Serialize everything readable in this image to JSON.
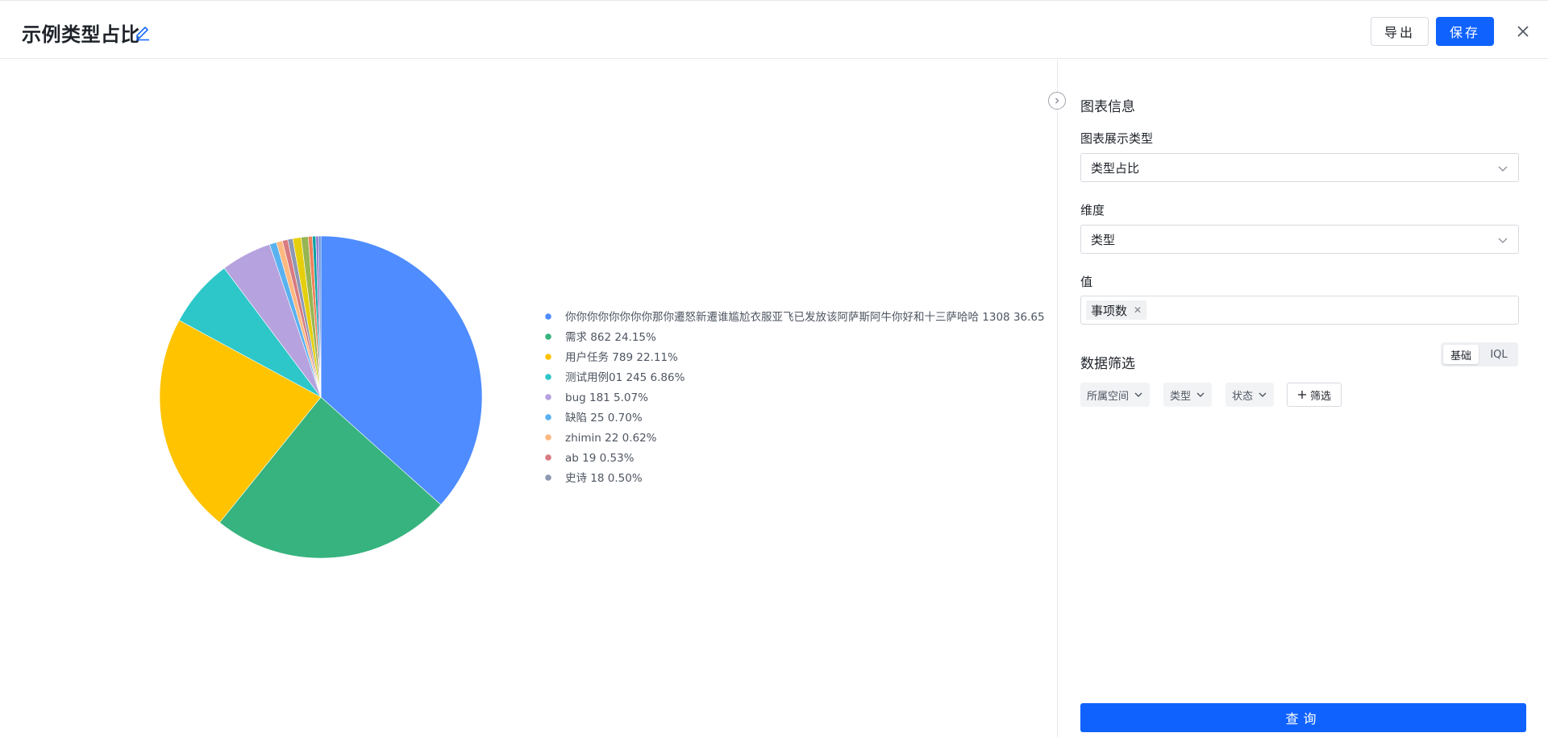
{
  "header": {
    "title": "示例类型占比",
    "export_label": "导出",
    "save_label": "保存"
  },
  "icons": {
    "edit": "pencil-icon",
    "close": "close-icon",
    "collapse": "chevron-right-circle-icon"
  },
  "panel": {
    "section_title": "图表信息",
    "chart_type_label": "图表展示类型",
    "chart_type_value": "类型占比",
    "dimension_label": "维度",
    "dimension_value": "类型",
    "value_label": "值",
    "value_tag": "事项数",
    "filter_title": "数据筛选",
    "mode_basic": "基础",
    "mode_iql": "IQL",
    "filters": [
      "所属空间",
      "类型",
      "状态"
    ],
    "add_filter_label": "筛选",
    "query_label": "查询"
  },
  "colors": {
    "primary": "#0f62fe",
    "border": "#d7dadf"
  },
  "chart_data": {
    "type": "pie",
    "legend_position": "right",
    "slices": [
      {
        "name": "你你你你你你你你那你遷怒新遷谁尴尬衣服亚飞已发放该阿萨斯阿牛你好和十三萨哈哈",
        "value": 1308,
        "percent": "36.65",
        "color": "#4e8cff"
      },
      {
        "name": "需求",
        "value": 862,
        "percent": "24.15%",
        "color": "#36b37e"
      },
      {
        "name": "用户任务",
        "value": 789,
        "percent": "22.11%",
        "color": "#ffc300"
      },
      {
        "name": "测试用例01",
        "value": 245,
        "percent": "6.86%",
        "color": "#2ec7c9"
      },
      {
        "name": "bug",
        "value": 181,
        "percent": "5.07%",
        "color": "#b6a2de"
      },
      {
        "name": "缺陷",
        "value": 25,
        "percent": "0.70%",
        "color": "#5ab1ef"
      },
      {
        "name": "zhimin",
        "value": 22,
        "percent": "0.62%",
        "color": "#ffb980"
      },
      {
        "name": "ab",
        "value": 19,
        "percent": "0.53%",
        "color": "#d87a80"
      },
      {
        "name": "史诗",
        "value": 18,
        "percent": "0.50%",
        "color": "#8d98b3"
      }
    ],
    "others": [
      {
        "value": 30,
        "color": "#e5cf0d"
      },
      {
        "value": 25,
        "color": "#97b552"
      },
      {
        "value": 15,
        "color": "#f0805a"
      },
      {
        "value": 12,
        "color": "#07a2a4"
      },
      {
        "value": 10,
        "color": "#9a7fd1"
      },
      {
        "value": 8,
        "color": "#588dd5"
      }
    ]
  }
}
